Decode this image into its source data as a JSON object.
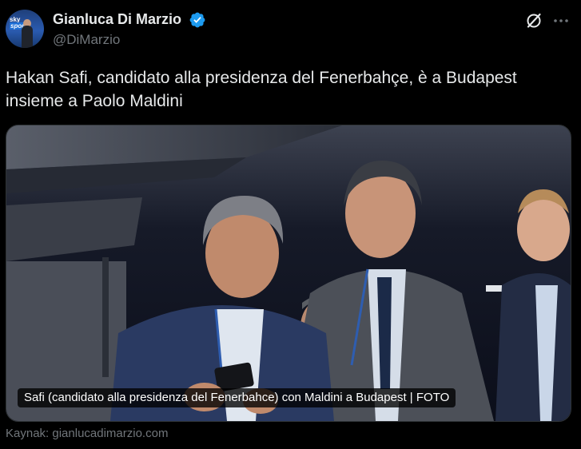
{
  "author": {
    "name": "Gianluca Di Marzio",
    "handle": "@DiMarzio",
    "verified": true,
    "avatar_logo_top": "sky",
    "avatar_logo_bottom": "sport"
  },
  "tweet": {
    "text_line1": "Hakan Safi, candidato alla presidenza del Fenerbahçe, è a Budapest",
    "text_line2": "insieme a Paolo Maldini"
  },
  "card": {
    "caption": "Safi (candidato alla presidenza del Fenerbahce) con Maldini a Budapest | FOTO"
  },
  "source": {
    "prefix": "Kaynak:",
    "domain": "gianlucadimarzio.com"
  },
  "colors": {
    "background": "#000000",
    "text": "#e7e9ea",
    "muted": "#71767b",
    "verified_blue": "#1d9bf0"
  },
  "icons": {
    "verified": "verified-badge-icon",
    "grok": "grok-icon",
    "more": "more-dots-icon"
  }
}
